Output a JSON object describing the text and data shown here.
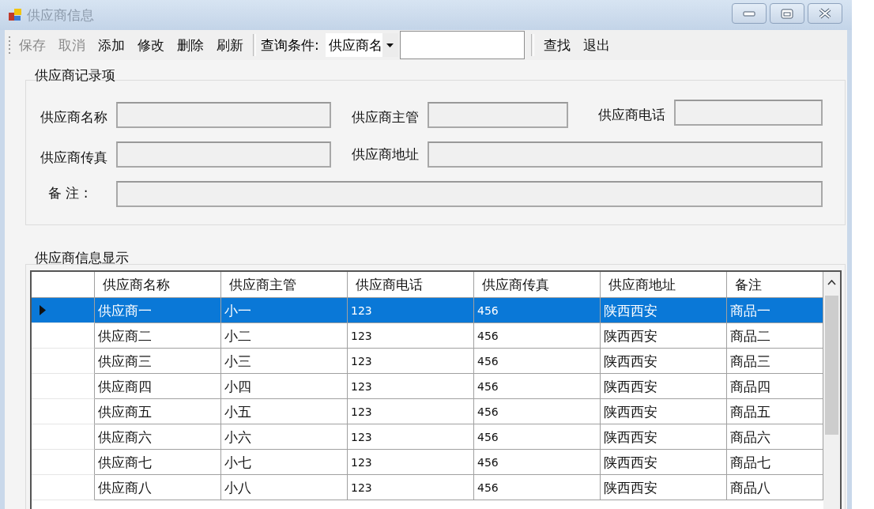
{
  "window": {
    "title": "供应商信息"
  },
  "toolbar": {
    "buttons": [
      {
        "label": "保存",
        "disabled": true
      },
      {
        "label": "取消",
        "disabled": true
      },
      {
        "label": "添加",
        "disabled": false
      },
      {
        "label": "修改",
        "disabled": false
      },
      {
        "label": "删除",
        "disabled": false
      },
      {
        "label": "刷新",
        "disabled": false
      }
    ],
    "query_label": "查询条件:",
    "query_combo": {
      "value": "供应商名"
    },
    "actions": [
      {
        "label": "查找",
        "disabled": false
      },
      {
        "label": "退出",
        "disabled": false
      }
    ]
  },
  "record_group": {
    "title": "供应商记录项",
    "fields": [
      {
        "label": "供应商名称"
      },
      {
        "label": "供应商主管"
      },
      {
        "label": "供应商电话"
      },
      {
        "label": "供应商传真"
      },
      {
        "label": "供应商地址"
      },
      {
        "label": "备  注 :"
      }
    ]
  },
  "grid_group": {
    "title": "供应商信息显示",
    "columns": [
      "供应商名称",
      "供应商主管",
      "供应商电话",
      "供应商传真",
      "供应商地址",
      "备注"
    ],
    "rows": [
      {
        "selected": true,
        "cells": [
          "供应商一",
          "小一",
          "123",
          "456",
          "陕西西安",
          "商品一"
        ]
      },
      {
        "selected": false,
        "cells": [
          "供应商二",
          "小二",
          "123",
          "456",
          "陕西西安",
          "商品二"
        ]
      },
      {
        "selected": false,
        "cells": [
          "供应商三",
          "小三",
          "123",
          "456",
          "陕西西安",
          "商品三"
        ]
      },
      {
        "selected": false,
        "cells": [
          "供应商四",
          "小四",
          "123",
          "456",
          "陕西西安",
          "商品四"
        ]
      },
      {
        "selected": false,
        "cells": [
          "供应商五",
          "小五",
          "123",
          "456",
          "陕西西安",
          "商品五"
        ]
      },
      {
        "selected": false,
        "cells": [
          "供应商六",
          "小六",
          "123",
          "456",
          "陕西西安",
          "商品六"
        ]
      },
      {
        "selected": false,
        "cells": [
          "供应商七",
          "小七",
          "123",
          "456",
          "陕西西安",
          "商品七"
        ]
      },
      {
        "selected": false,
        "cells": [
          "供应商八",
          "小八",
          "123",
          "456",
          "陕西西安",
          "商品八"
        ]
      }
    ]
  }
}
